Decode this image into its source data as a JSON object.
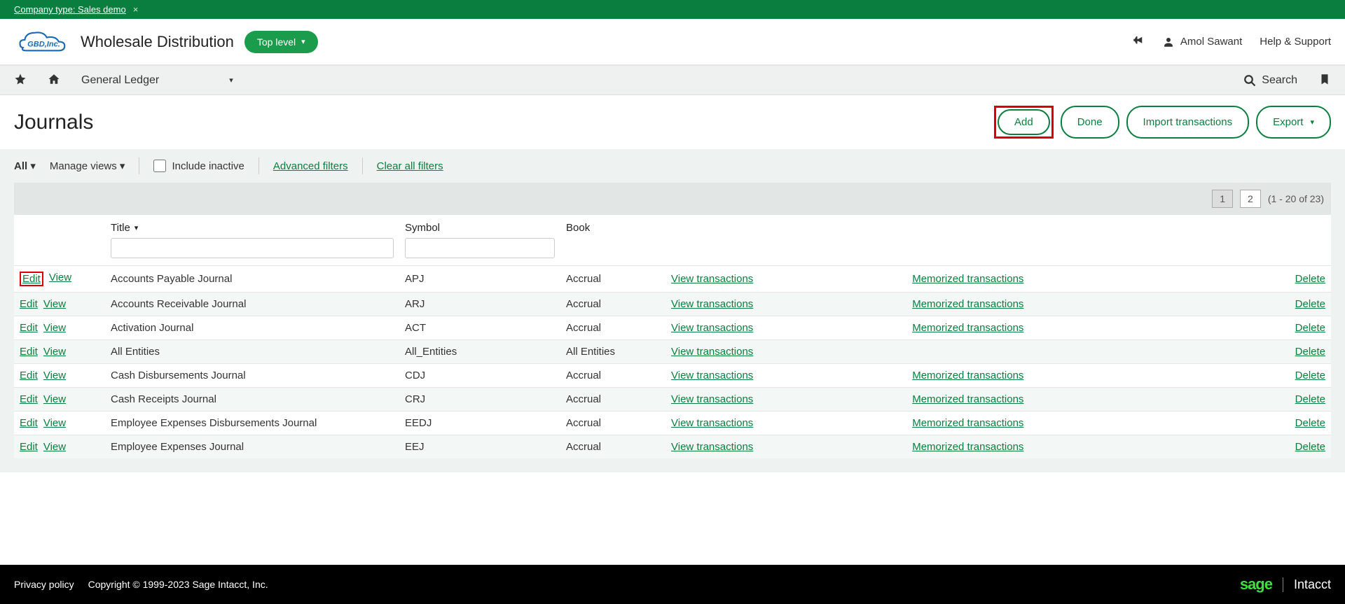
{
  "banner": {
    "text": "Company type: Sales demo",
    "close": "×"
  },
  "header": {
    "app_title": "Wholesale Distribution",
    "top_level": "Top level",
    "user_name": "Amol Sawant",
    "help": "Help & Support"
  },
  "nav": {
    "module": "General Ledger",
    "search": "Search"
  },
  "page": {
    "title": "Journals",
    "actions": {
      "add": "Add",
      "done": "Done",
      "import": "Import transactions",
      "export": "Export"
    }
  },
  "filters": {
    "all": "All",
    "manage_views": "Manage views",
    "include_inactive": "Include inactive",
    "advanced": "Advanced filters",
    "clear": "Clear all filters"
  },
  "pager": {
    "p1": "1",
    "p2": "2",
    "range": "(1 - 20 of 23)"
  },
  "columns": {
    "title": "Title",
    "symbol": "Symbol",
    "book": "Book"
  },
  "row_labels": {
    "edit": "Edit",
    "view": "View",
    "view_tx": "View transactions",
    "mem_tx": "Memorized transactions",
    "delete": "Delete"
  },
  "rows": [
    {
      "title": "Accounts Payable Journal",
      "symbol": "APJ",
      "book": "Accrual",
      "mem": true
    },
    {
      "title": "Accounts Receivable Journal",
      "symbol": "ARJ",
      "book": "Accrual",
      "mem": true
    },
    {
      "title": "Activation Journal",
      "symbol": "ACT",
      "book": "Accrual",
      "mem": true
    },
    {
      "title": "All Entities",
      "symbol": "All_Entities",
      "book": "All Entities",
      "mem": false
    },
    {
      "title": "Cash Disbursements Journal",
      "symbol": "CDJ",
      "book": "Accrual",
      "mem": true
    },
    {
      "title": "Cash Receipts Journal",
      "symbol": "CRJ",
      "book": "Accrual",
      "mem": true
    },
    {
      "title": "Employee Expenses Disbursements Journal",
      "symbol": "EEDJ",
      "book": "Accrual",
      "mem": true
    },
    {
      "title": "Employee Expenses Journal",
      "symbol": "EEJ",
      "book": "Accrual",
      "mem": true
    }
  ],
  "footer": {
    "privacy": "Privacy policy",
    "copyright": "Copyright © 1999-2023 Sage Intacct, Inc.",
    "brand1": "sage",
    "brand2": "Intacct"
  }
}
